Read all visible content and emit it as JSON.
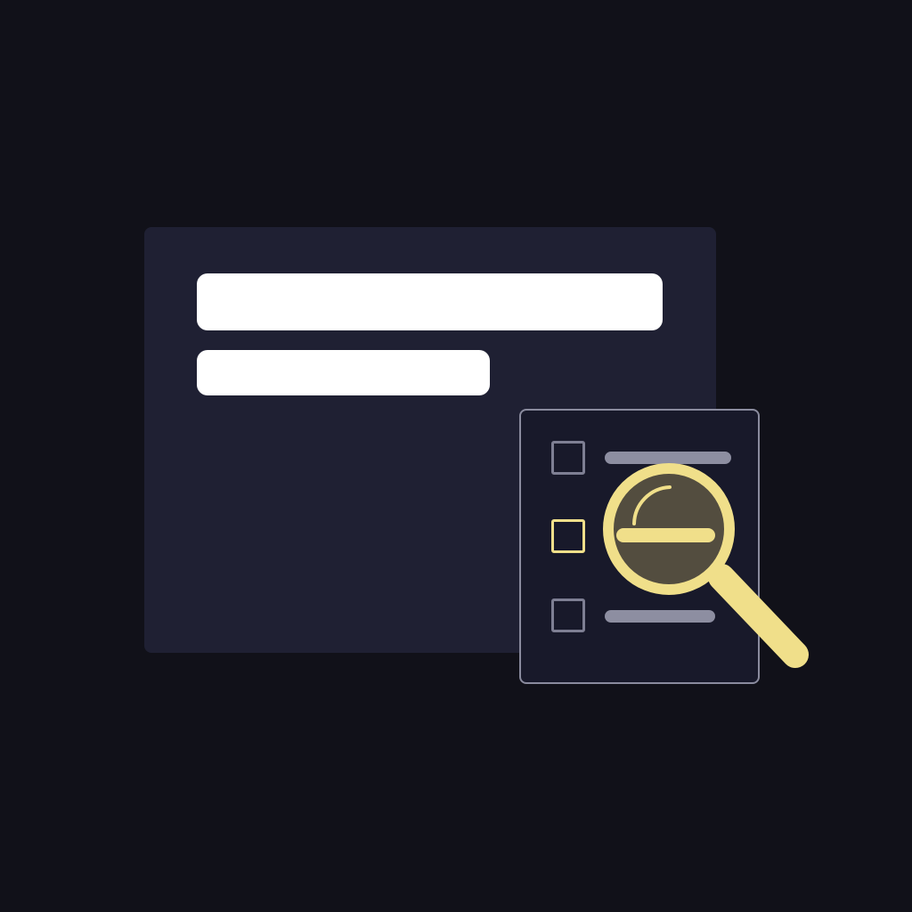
{
  "illustration": {
    "background_color": "#111119",
    "panel_color": "#1f2033",
    "placeholder_bar_color": "#ffffff",
    "card_border_color": "#8a8b9e",
    "checkbox_color": "#7e7f93",
    "accent_color": "#f0df8a",
    "icons": [
      "checkbox-icon",
      "magnifying-glass-icon"
    ],
    "checklist": {
      "items_count": 3,
      "highlighted_item": 2
    }
  }
}
